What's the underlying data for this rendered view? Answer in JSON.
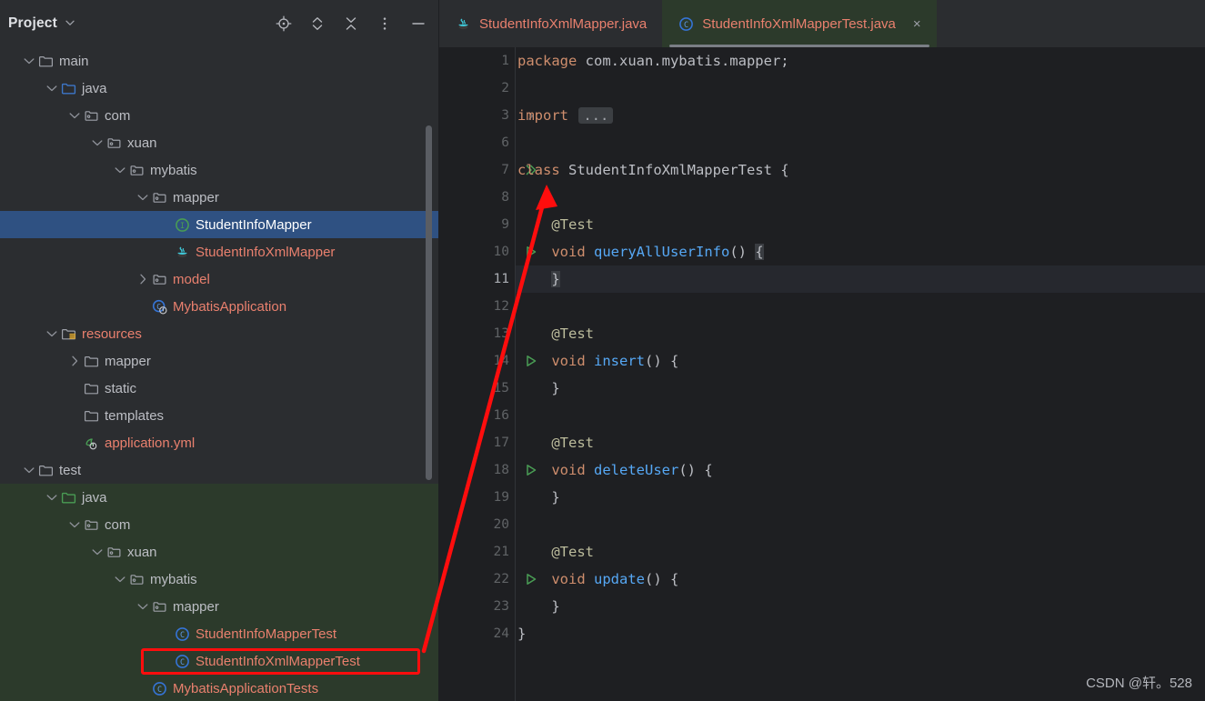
{
  "panel": {
    "title": "Project",
    "title_chevron": "chevron-down-icon",
    "tools": [
      {
        "name": "locate-target-icon",
        "label": "Select Opened File"
      },
      {
        "name": "expand-all-icon",
        "label": "Expand All"
      },
      {
        "name": "collapse-all-icon",
        "label": "Collapse All"
      },
      {
        "name": "more-options-icon",
        "label": "More Options"
      },
      {
        "name": "minimize-icon",
        "label": "Hide"
      }
    ],
    "tree": [
      {
        "depth": 1,
        "twist": "down",
        "icon": "folder",
        "label": "main",
        "style": "plain",
        "bg": "none"
      },
      {
        "depth": 2,
        "twist": "down",
        "icon": "folder-source",
        "label": "java",
        "style": "plain",
        "bg": "none"
      },
      {
        "depth": 3,
        "twist": "down",
        "icon": "package",
        "label": "com",
        "style": "plain",
        "bg": "none"
      },
      {
        "depth": 4,
        "twist": "down",
        "icon": "package",
        "label": "xuan",
        "style": "plain",
        "bg": "none"
      },
      {
        "depth": 5,
        "twist": "down",
        "icon": "package",
        "label": "mybatis",
        "style": "plain",
        "bg": "none"
      },
      {
        "depth": 6,
        "twist": "down",
        "icon": "package",
        "label": "mapper",
        "style": "plain",
        "bg": "none"
      },
      {
        "depth": 7,
        "twist": "none",
        "icon": "interface",
        "label": "StudentInfoMapper",
        "style": "plain",
        "bg": "selected"
      },
      {
        "depth": 7,
        "twist": "none",
        "icon": "java-file",
        "label": "StudentInfoXmlMapper",
        "style": "orange",
        "bg": "none"
      },
      {
        "depth": 6,
        "twist": "right",
        "icon": "package",
        "label": "model",
        "style": "orange",
        "bg": "none"
      },
      {
        "depth": 6,
        "twist": "none",
        "icon": "spring-class",
        "label": "MybatisApplication",
        "style": "orange",
        "bg": "none"
      },
      {
        "depth": 2,
        "twist": "down",
        "icon": "folder-res",
        "label": "resources",
        "style": "orange",
        "bg": "none"
      },
      {
        "depth": 3,
        "twist": "right",
        "icon": "folder",
        "label": "mapper",
        "style": "plain",
        "bg": "none"
      },
      {
        "depth": 3,
        "twist": "none",
        "icon": "folder",
        "label": "static",
        "style": "plain",
        "bg": "none"
      },
      {
        "depth": 3,
        "twist": "none",
        "icon": "folder",
        "label": "templates",
        "style": "plain",
        "bg": "none"
      },
      {
        "depth": 3,
        "twist": "none",
        "icon": "yml-file",
        "label": "application.yml",
        "style": "orange",
        "bg": "none"
      },
      {
        "depth": 1,
        "twist": "down",
        "icon": "folder",
        "label": "test",
        "style": "plain",
        "bg": "none"
      },
      {
        "depth": 2,
        "twist": "down",
        "icon": "folder-test",
        "label": "java",
        "style": "plain",
        "bg": "green"
      },
      {
        "depth": 3,
        "twist": "down",
        "icon": "package",
        "label": "com",
        "style": "plain",
        "bg": "green"
      },
      {
        "depth": 4,
        "twist": "down",
        "icon": "package",
        "label": "xuan",
        "style": "plain",
        "bg": "green"
      },
      {
        "depth": 5,
        "twist": "down",
        "icon": "package",
        "label": "mybatis",
        "style": "plain",
        "bg": "green"
      },
      {
        "depth": 6,
        "twist": "down",
        "icon": "package",
        "label": "mapper",
        "style": "plain",
        "bg": "green"
      },
      {
        "depth": 7,
        "twist": "none",
        "icon": "class",
        "label": "StudentInfoMapperTest",
        "style": "orange",
        "bg": "green"
      },
      {
        "depth": 7,
        "twist": "none",
        "icon": "class",
        "label": "StudentInfoXmlMapperTest",
        "style": "orange",
        "bg": "green",
        "highlight": true
      },
      {
        "depth": 6,
        "twist": "none",
        "icon": "class",
        "label": "MybatisApplicationTests",
        "style": "orange",
        "bg": "green"
      }
    ]
  },
  "editor": {
    "tabs": [
      {
        "label": "StudentInfoXmlMapper.java",
        "icon": "java-file-icon",
        "active": false,
        "closable": false
      },
      {
        "label": "StudentInfoXmlMapperTest.java",
        "icon": "class-icon",
        "active": true,
        "closable": true,
        "close_glyph": "×"
      }
    ],
    "lines": [
      {
        "num": "1",
        "gutter": "none",
        "indent": 0,
        "tokens": [
          {
            "t": "package ",
            "c": "kw"
          },
          {
            "t": "com.xuan.mybatis.mapper;",
            "c": "pkg"
          }
        ]
      },
      {
        "num": "2",
        "gutter": "none",
        "indent": 0,
        "tokens": []
      },
      {
        "num": "3",
        "gutter": "fold",
        "indent": 0,
        "tokens": [
          {
            "t": "import ",
            "c": "kw"
          },
          {
            "t": "...",
            "c": "fold"
          }
        ]
      },
      {
        "num": "6",
        "gutter": "none",
        "indent": 0,
        "tokens": []
      },
      {
        "num": "7",
        "gutter": "run-class",
        "indent": 0,
        "tokens": [
          {
            "t": "class ",
            "c": "kw"
          },
          {
            "t": "StudentInfoXmlMapperTest",
            "c": "id"
          },
          {
            "t": " {",
            "c": "pun"
          }
        ]
      },
      {
        "num": "8",
        "gutter": "none",
        "indent": 0,
        "tokens": []
      },
      {
        "num": "9",
        "gutter": "none",
        "indent": 1,
        "tokens": [
          {
            "t": "@Test",
            "c": "ann"
          }
        ]
      },
      {
        "num": "10",
        "gutter": "run-method",
        "indent": 1,
        "tokens": [
          {
            "t": "void ",
            "c": "kw"
          },
          {
            "t": "queryAllUserInfo",
            "c": "mth"
          },
          {
            "t": "() ",
            "c": "pun"
          },
          {
            "t": "{",
            "c": "brace"
          }
        ]
      },
      {
        "num": "11",
        "gutter": "none",
        "indent": 1,
        "current": true,
        "tokens": [
          {
            "t": "}",
            "c": "brace"
          }
        ]
      },
      {
        "num": "12",
        "gutter": "none",
        "indent": 0,
        "tokens": []
      },
      {
        "num": "13",
        "gutter": "none",
        "indent": 1,
        "tokens": [
          {
            "t": "@Test",
            "c": "ann"
          }
        ]
      },
      {
        "num": "14",
        "gutter": "run-method",
        "indent": 1,
        "tokens": [
          {
            "t": "void ",
            "c": "kw"
          },
          {
            "t": "insert",
            "c": "mth"
          },
          {
            "t": "() {",
            "c": "pun"
          }
        ]
      },
      {
        "num": "15",
        "gutter": "none",
        "indent": 1,
        "tokens": [
          {
            "t": "}",
            "c": "pun"
          }
        ]
      },
      {
        "num": "16",
        "gutter": "none",
        "indent": 0,
        "tokens": []
      },
      {
        "num": "17",
        "gutter": "none",
        "indent": 1,
        "tokens": [
          {
            "t": "@Test",
            "c": "ann"
          }
        ]
      },
      {
        "num": "18",
        "gutter": "run-method",
        "indent": 1,
        "tokens": [
          {
            "t": "void ",
            "c": "kw"
          },
          {
            "t": "deleteUser",
            "c": "mth"
          },
          {
            "t": "() {",
            "c": "pun"
          }
        ]
      },
      {
        "num": "19",
        "gutter": "none",
        "indent": 1,
        "tokens": [
          {
            "t": "}",
            "c": "pun"
          }
        ]
      },
      {
        "num": "20",
        "gutter": "none",
        "indent": 0,
        "tokens": []
      },
      {
        "num": "21",
        "gutter": "none",
        "indent": 1,
        "tokens": [
          {
            "t": "@Test",
            "c": "ann"
          }
        ]
      },
      {
        "num": "22",
        "gutter": "run-method",
        "indent": 1,
        "tokens": [
          {
            "t": "void ",
            "c": "kw"
          },
          {
            "t": "update",
            "c": "mth"
          },
          {
            "t": "() {",
            "c": "pun"
          }
        ]
      },
      {
        "num": "23",
        "gutter": "none",
        "indent": 1,
        "tokens": [
          {
            "t": "}",
            "c": "pun"
          }
        ]
      },
      {
        "num": "24",
        "gutter": "none",
        "indent": 0,
        "tokens": [
          {
            "t": "}",
            "c": "pun"
          }
        ]
      }
    ]
  },
  "watermark": "CSDN @轩。528",
  "colors": {
    "panel_bg": "#2B2D30",
    "editor_bg": "#1E1F22",
    "selection_blue": "#2F5182",
    "test_root_green": "#2C3A2B",
    "annotation_red": "#FF0D0D",
    "keyword_orange": "#CF8E6D",
    "method_blue": "#56A8F5",
    "annotation_yellow": "#BCBC9C",
    "file_orange": "#E9806E",
    "text_gray": "#BCBEC4"
  }
}
